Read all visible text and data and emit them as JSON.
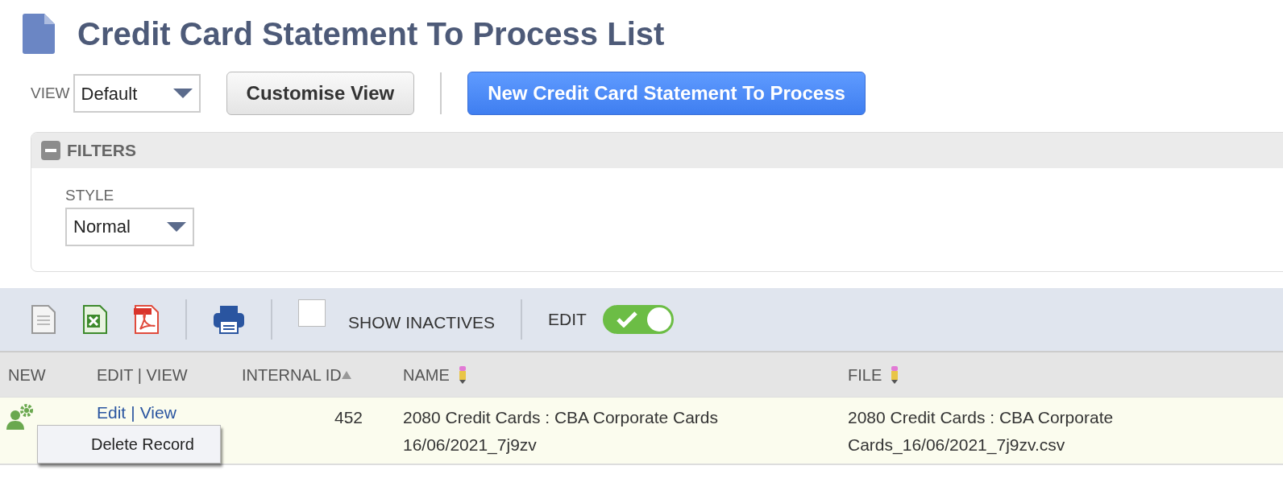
{
  "page": {
    "title": "Credit Card Statement To Process List"
  },
  "view": {
    "label": "VIEW",
    "value": "Default"
  },
  "buttons": {
    "customise": "Customise View",
    "new": "New Credit Card Statement To Process"
  },
  "filters": {
    "title": "FILTERS",
    "expanded": true,
    "style_label": "STYLE",
    "style_value": "Normal"
  },
  "toolbar": {
    "show_inactives": {
      "label": "SHOW INACTIVES",
      "checked": false
    },
    "edit": {
      "label": "EDIT",
      "on": true
    }
  },
  "table": {
    "columns": [
      {
        "label": "NEW",
        "sorted": false,
        "editable": false
      },
      {
        "label": "EDIT | VIEW",
        "sorted": false,
        "editable": false
      },
      {
        "label": "INTERNAL ID",
        "sorted": true,
        "editable": false
      },
      {
        "label": "NAME",
        "sorted": false,
        "editable": true
      },
      {
        "label": "FILE",
        "sorted": false,
        "editable": true
      }
    ],
    "rows": [
      {
        "edit_link": "Edit",
        "link_separator": "|",
        "view_link": "View",
        "internal_id": "452",
        "name": "2080 Credit Cards : CBA Corporate Cards 16/06/2021_7j9zv",
        "file": "2080 Credit Cards : CBA Corporate Cards_16/06/2021_7j9zv.csv"
      }
    ]
  },
  "context_menu": {
    "items": [
      "Delete Record"
    ]
  }
}
